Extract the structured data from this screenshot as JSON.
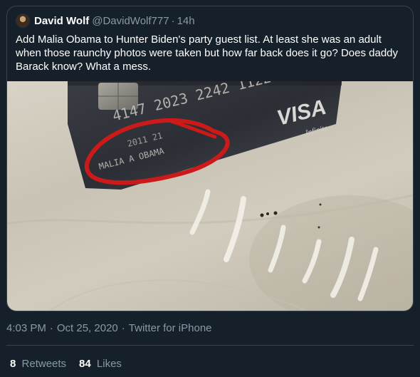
{
  "quoted_tweet": {
    "author_name": "David Wolf",
    "author_handle": "@DavidWolf777",
    "separator": "·",
    "time_ago": "14h",
    "text": "Add Malia Obama to Hunter Biden's party guest list. At least she was an adult when those raunchy photos were taken but how far back does it go? Does daddy Barack know? What a mess.",
    "media": {
      "card_number_line1": "4147 2023 2242 1122",
      "card_number_line2": "2011 21",
      "card_name": "MALIA A OBAMA",
      "card_brand": "VISA",
      "card_tier": "Infinite",
      "circle_color": "#cc1a1a"
    }
  },
  "tweet_meta": {
    "time": "4:03 PM",
    "date": "Oct 25, 2020",
    "source": "Twitter for iPhone",
    "separator": "·"
  },
  "stats": {
    "retweets_count": "8",
    "retweets_label": "Retweets",
    "likes_count": "84",
    "likes_label": "Likes"
  },
  "colors": {
    "background": "#15202b",
    "border": "#38444d",
    "secondary_text": "#8899a6",
    "primary_text": "#ffffff"
  }
}
